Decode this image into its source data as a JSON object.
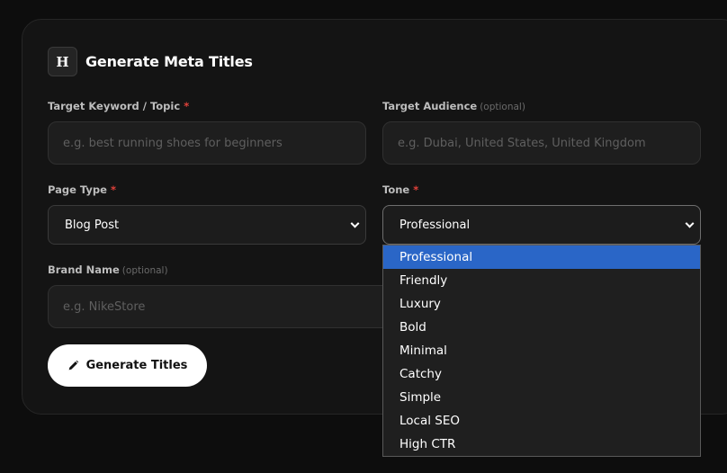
{
  "header": {
    "badge": "H",
    "title": "Generate Meta Titles"
  },
  "fields": {
    "keyword": {
      "label": "Target Keyword / Topic",
      "required_mark": "*",
      "placeholder": "e.g. best running shoes for beginners"
    },
    "audience": {
      "label": "Target Audience",
      "optional_text": "(optional)",
      "placeholder": "e.g. Dubai, United States, United Kingdom"
    },
    "page_type": {
      "label": "Page Type",
      "required_mark": "*",
      "value": "Blog Post"
    },
    "tone": {
      "label": "Tone",
      "required_mark": "*",
      "value": "Professional"
    },
    "brand": {
      "label": "Brand Name",
      "optional_text": "(optional)",
      "placeholder": "e.g. NikeStore"
    }
  },
  "generate_button": {
    "label": "Generate Titles",
    "icon": "pencil-icon"
  },
  "tone_dropdown": {
    "selected": "Professional",
    "options": [
      "Professional",
      "Friendly",
      "Luxury",
      "Bold",
      "Minimal",
      "Catchy",
      "Simple",
      "Local SEO",
      "High CTR"
    ]
  },
  "colors": {
    "background": "#0d0d0d",
    "card": "#141414",
    "required": "#e0413a",
    "highlight": "#2a66c7",
    "button": "#ffffff"
  }
}
